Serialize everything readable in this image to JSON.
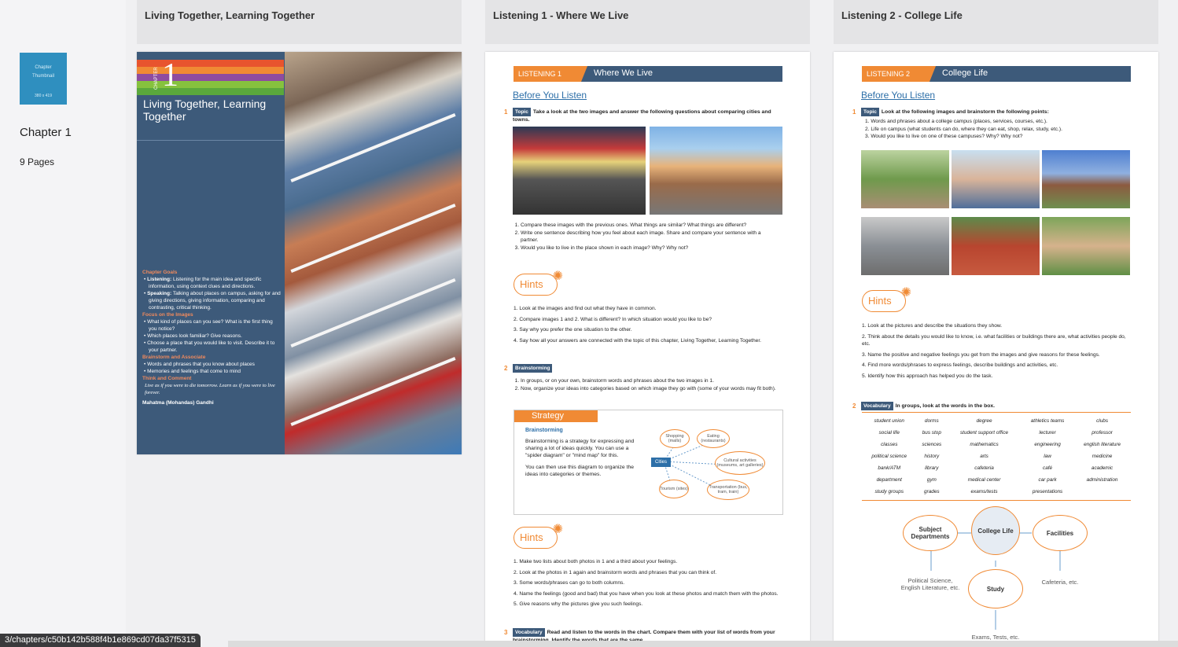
{
  "sidebar": {
    "thumbnail_line1": "Chapter",
    "thumbnail_line2": "Thumbnail",
    "thumbnail_dims": "380 x 419",
    "chapter_title": "Chapter 1",
    "pages_count": "9 Pages"
  },
  "columns": [
    {
      "title": "Living Together, Learning Together"
    },
    {
      "title": "Listening 1 - Where We Live"
    },
    {
      "title": "Listening 2 - College Life"
    }
  ],
  "cover": {
    "chapter_word": "CHAPTER",
    "chapter_number": "1",
    "title": "Living Together, Learning Together",
    "goals_heading": "Chapter Goals",
    "goal1_bold": "Listening:",
    "goal1": " Listening for the main idea and specific information, using context clues and directions.",
    "goal2_bold": "Speaking:",
    "goal2": " Talking about places on campus, asking for and giving directions, giving information, comparing and contrasting, critical thinking.",
    "focus_heading": "Focus on the Images",
    "focus1": "What kind of places can you see? What is the first thing you notice?",
    "focus2": "Which places look familiar? Give reasons.",
    "focus3": "Choose a place that you would like to visit. Describe it to your partner.",
    "brainstorm_heading": "Brainstorm and Associate",
    "brainstorm1": "Words and phrases that you know about places",
    "brainstorm2": "Memories and feelings that come to mind",
    "think_heading": "Think and Comment",
    "quote": "Live as if you were to die tomorrow. Learn as if you were to live forever.",
    "author": "Mahatma (Mohandas) Gandhi",
    "stripe_colors": [
      "#e8542e",
      "#f08a34",
      "#8e4ca0",
      "#86c23e",
      "#5aa83c"
    ]
  },
  "listening1": {
    "tag": "LISTENING 1",
    "name": "Where We Live",
    "section": "Before You Listen",
    "n1": "1",
    "topic_pill": "Topic",
    "topic_instr": "Take a look at the two images and answer the following questions about comparing cities and towns.",
    "questions": [
      "Compare these images with the previous ones. What things are similar? What things are different?",
      "Write one sentence describing how you feel about each image. Share and compare your sentence with a partner.",
      "Would you like to live in the place shown in each image? Why? Why not?"
    ],
    "hints_label": "Hints",
    "hints1": [
      "1. Look at the images and find out what they have in common.",
      "2. Compare images 1 and 2. What is different? In which situation would you like to be?",
      "3. Say why you prefer the one situation to the other.",
      "4. Say how all your answers are connected with the topic of this chapter, Living Together, Learning Together."
    ],
    "n2": "2",
    "brainstorm_pill": "Brainstorming",
    "brainstorm_items": [
      "In groups, or on your own, brainstorm words and phrases about the two images in 1.",
      "Now, organize your ideas into categories based on which image they go with (some of your words may fit both)."
    ],
    "strategy_tab": "Strategy",
    "strategy_heading": "Brainstorming",
    "strategy_p1": "Brainstorming is a strategy for expressing and sharing a lot of ideas quickly. You can use a \"spider diagram\" or \"mind map\" for this.",
    "strategy_p2": "You can then use this diagram to organize the ideas into categories or themes.",
    "diagram_center": "Cities",
    "diagram_nodes": [
      "Shopping (malls)",
      "Eating (restaurants)",
      "Cultural activities (museums, art galleries)",
      "Transportation (bus, tram, train)",
      "Tourism (sites)"
    ],
    "hints2": [
      "1. Make two lists about both photos in 1 and a third about your feelings.",
      "2. Look at the photos in 1 again and brainstorm words and phrases that you can think of.",
      "3. Some words/phrases can go to both columns.",
      "4. Name the feelings (good and bad) that you have when you look at these photos and match them with the photos.",
      "5. Give reasons why the pictures give you such feelings."
    ],
    "n3": "3",
    "vocab_pill": "Vocabulary",
    "vocab_instr": "Read and listen to the words in the chart. Compare them with your list of words from your brainstorming. Identify the words that are the same."
  },
  "listening2": {
    "tag": "LISTENING 2",
    "name": "College Life",
    "section": "Before You Listen",
    "n1": "1",
    "topic_pill": "Topic",
    "topic_instr": "Look at the following images and brainstorm the following points:",
    "points": [
      "1. Words and phrases about a college campus (places, services, courses, etc.).",
      "2. Life on campus (what students can do, where they can eat, shop, relax, study, etc.).",
      "3. Would you like to live on one of these campuses? Why? Why not?"
    ],
    "hints_label": "Hints",
    "hints": [
      "1. Look at the pictures and describe the situations they show.",
      "2. Think about the details you would like to know, i.e. what facilities or buildings there are, what activities people do, etc.",
      "3. Name the positive and negative feelings you get from the images and give reasons for these feelings.",
      "4. Find more words/phrases to express feelings, describe buildings and activities, etc.",
      "5. Identify how this approach has helped you do the task."
    ],
    "n2": "2",
    "vocab_pill": "Vocabulary",
    "vocab_instr": "In groups, look at the words in the box.",
    "vocab_rows": [
      [
        "student union",
        "dorms",
        "degree",
        "athletics teams",
        "clubs"
      ],
      [
        "social life",
        "bus stop",
        "student support office",
        "lecturer",
        "professor"
      ],
      [
        "classes",
        "sciences",
        "mathematics",
        "engineering",
        "english literature"
      ],
      [
        "political science",
        "history",
        "arts",
        "law",
        "medicine"
      ],
      [
        "bank/ATM",
        "library",
        "cafeteria",
        "café",
        "academic"
      ],
      [
        "department",
        "gym",
        "medical center",
        "car park",
        "administration"
      ],
      [
        "study groups",
        "grades",
        "exams/tests",
        "presentations",
        ""
      ]
    ],
    "diagram": {
      "center": "College Life",
      "left": "Subject Departments",
      "right": "Facilities",
      "bottom": "Study",
      "left_text": "Political Science, English Literature, etc.",
      "right_text": "Cafeteria, etc.",
      "bottom_text": "Exams, Tests, etc."
    }
  },
  "status_url": "3/chapters/c50b142b588f4b1e869cd07da37f5315"
}
